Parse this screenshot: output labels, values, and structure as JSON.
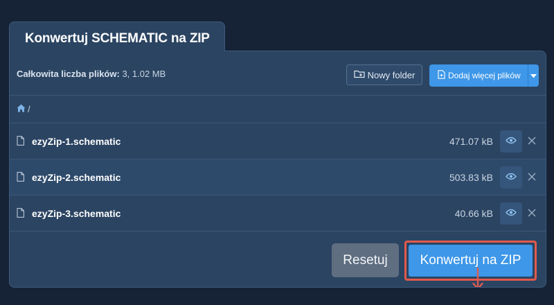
{
  "tab": {
    "title": "Konwertuj SCHEMATIC na ZIP"
  },
  "toolbar": {
    "summary_label": "Całkowita liczba plików:",
    "summary_value": "3, 1.02 MB",
    "new_folder_label": "Nowy folder",
    "add_files_label": "Dodaj więcej plików"
  },
  "breadcrumb": {
    "separator": "/"
  },
  "files": [
    {
      "name": "ezyZip-1.schematic",
      "size": "471.07 kB"
    },
    {
      "name": "ezyZip-2.schematic",
      "size": "503.83 kB"
    },
    {
      "name": "ezyZip-3.schematic",
      "size": "40.66 kB"
    }
  ],
  "actions": {
    "reset_label": "Resetuj",
    "convert_label": "Konwertuj na ZIP"
  },
  "colors": {
    "background": "#162336",
    "panel": "#2b4462",
    "accent": "#3e97e8",
    "highlight": "#e25a4e",
    "reset": "#5f6e80"
  },
  "icons": [
    "folder-plus-icon",
    "file-plus-icon",
    "chevron-down-icon",
    "home-icon",
    "file-icon",
    "eye-icon",
    "close-icon",
    "arrow-down-icon"
  ]
}
